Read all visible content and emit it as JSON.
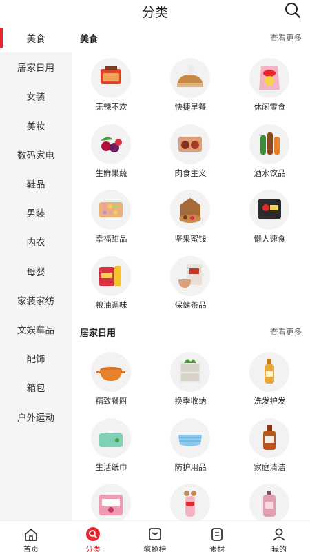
{
  "header": {
    "title": "分类"
  },
  "sidebar": {
    "items": [
      {
        "label": "美食"
      },
      {
        "label": "居家日用"
      },
      {
        "label": "女装"
      },
      {
        "label": "美妆"
      },
      {
        "label": "数码家电"
      },
      {
        "label": "鞋品"
      },
      {
        "label": "男装"
      },
      {
        "label": "内衣"
      },
      {
        "label": "母婴"
      },
      {
        "label": "家装家纺"
      },
      {
        "label": "文娱车品"
      },
      {
        "label": "配饰"
      },
      {
        "label": "箱包"
      },
      {
        "label": "户外运动"
      }
    ]
  },
  "sections": [
    {
      "title": "美食",
      "more": "查看更多",
      "items": [
        {
          "label": "无辣不欢",
          "icon": "spicy-snack-icon"
        },
        {
          "label": "快捷早餐",
          "icon": "bread-breakfast-icon"
        },
        {
          "label": "休闲零食",
          "icon": "chips-snack-icon"
        },
        {
          "label": "生鲜果蔬",
          "icon": "fresh-fruit-icon"
        },
        {
          "label": "肉食主义",
          "icon": "meat-icon"
        },
        {
          "label": "酒水饮品",
          "icon": "drinks-icon"
        },
        {
          "label": "幸福甜品",
          "icon": "macaron-icon"
        },
        {
          "label": "坚果蜜饯",
          "icon": "nuts-icon"
        },
        {
          "label": "懒人速食",
          "icon": "instant-noodle-icon"
        },
        {
          "label": "粮油调味",
          "icon": "rice-oil-icon"
        },
        {
          "label": "保健茶品",
          "icon": "tea-icon"
        }
      ]
    },
    {
      "title": "居家日用",
      "more": "查看更多",
      "items": [
        {
          "label": "精致餐厨",
          "icon": "cooking-pot-icon"
        },
        {
          "label": "换季收纳",
          "icon": "storage-drawer-icon"
        },
        {
          "label": "洗发护发",
          "icon": "shampoo-icon"
        },
        {
          "label": "生活纸巾",
          "icon": "tissue-icon"
        },
        {
          "label": "防护用品",
          "icon": "face-mask-icon"
        },
        {
          "label": "家庭清洁",
          "icon": "disinfectant-icon"
        },
        {
          "label": "",
          "icon": "pad-package-icon"
        },
        {
          "label": "",
          "icon": "bottle-icon"
        },
        {
          "label": "",
          "icon": "body-spray-icon"
        }
      ]
    }
  ],
  "tabbar": {
    "tabs": [
      {
        "label": "首页",
        "icon": "home-icon"
      },
      {
        "label": "分类",
        "icon": "category-icon"
      },
      {
        "label": "疯抢榜",
        "icon": "ranking-icon"
      },
      {
        "label": "素材",
        "icon": "material-icon"
      },
      {
        "label": "我的",
        "icon": "profile-icon"
      }
    ]
  },
  "colors": {
    "accent": "#e8262b",
    "sidebar_bg": "#f5f5f5",
    "thumb_bg": "#f2f2f2"
  }
}
